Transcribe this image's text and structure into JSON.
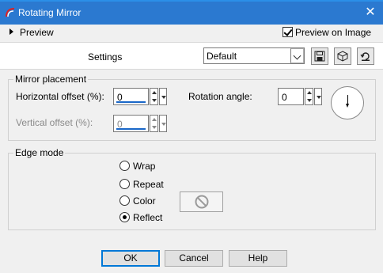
{
  "window": {
    "title": "Rotating Mirror",
    "icon_name": "app-icon",
    "close_icon": "close-icon",
    "titlebar_color": "#2b79d0"
  },
  "preview": {
    "label": "Preview",
    "preview_on_image_label": "Preview on Image",
    "preview_on_image_checked": true
  },
  "settings": {
    "label": "Settings",
    "value": "Default",
    "icons": [
      "save-preset-icon",
      "preset-3d-icon",
      "reset-icon"
    ]
  },
  "mirror_placement": {
    "title": "Mirror placement",
    "horizontal_label": "Horizontal offset (%):",
    "horizontal_value": "0",
    "vertical_label": "Vertical offset (%):",
    "vertical_value": "0",
    "vertical_enabled": false,
    "rotation_label": "Rotation angle:",
    "rotation_value": "0"
  },
  "edge_mode": {
    "title": "Edge mode",
    "options": [
      {
        "label": "Wrap",
        "selected": false
      },
      {
        "label": "Repeat",
        "selected": false
      },
      {
        "label": "Color",
        "selected": false
      },
      {
        "label": "Reflect",
        "selected": true
      }
    ]
  },
  "buttons": {
    "ok": "OK",
    "cancel": "Cancel",
    "help": "Help"
  },
  "accent_color": "#0078d7"
}
